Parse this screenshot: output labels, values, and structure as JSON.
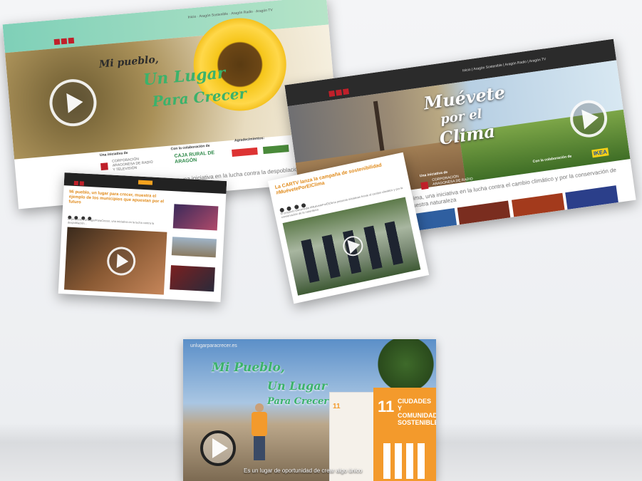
{
  "card1": {
    "title_line1": "Mi pueblo,",
    "title_line2": "Un Lugar",
    "title_line3": "Para Crecer",
    "sponsor_caption": "Una iniciativa de",
    "sponsor_org": "CORPORACIÓN ARAGONESA DE RADIO Y TELEVISIÓN",
    "collab_caption": "Con la colaboración de",
    "collab_org": "CAJA RURAL DE ARAGÓN",
    "thanks_caption": "Agradecimientos:",
    "tagline": "#UnLugarParaCrecer, una iniciativa en la lucha contra la despoblación",
    "nav_items": [
      "Inicio",
      "Aragón Sostenible",
      "Aragón Radio",
      "Aragón TV"
    ]
  },
  "card2": {
    "title_line1": "Muévete",
    "title_line2": "por el",
    "title_line3": "Clima",
    "sponsor_caption": "Una iniciativa de",
    "sponsor_org": "CORPORACIÓN ARAGONESA DE RADIO Y TELEVISIÓN",
    "collab_caption": "Con la colaboración de",
    "collab_org": "IKEA",
    "tagline": "...ima, una iniciativa en la lucha contra el cambio climático y por la conservación de nuestra naturaleza",
    "nav_items": [
      "Inicio",
      "Aragón Sostenible",
      "Aragón Radio",
      "Aragón TV"
    ]
  },
  "card3": {
    "headline": "Mi pueblo, un lugar para crecer, muestra el ejemplo de los municipios que apuestan por el futuro",
    "body": "El proyecto #UnLugarParaCrecer, una iniciativa en la lucha contra la despoblación..."
  },
  "card4": {
    "headline": "La CARTV lanza la campaña de sostenibilidad #MuévetePorElClima",
    "body": "El proyecto transmedia #MuévetePorElClima presenta iniciativas frente al cambio climático y por la conservación de la naturaleza"
  },
  "card5": {
    "url": "unlugarparacrecer.es",
    "title_line1": "Mi Pueblo,",
    "title_line2": "Un Lugar",
    "title_line3": "Para Crecer",
    "cube_number": "11",
    "cube_text": "CIUDADES Y COMUNIDADES SOSTENIBLES",
    "caption": "Es un lugar de oportunidad de crear algo único"
  },
  "colors": {
    "accent_green": "#3bb26b",
    "brand_red": "#c0202a",
    "sdg_orange": "#f39a2c"
  }
}
